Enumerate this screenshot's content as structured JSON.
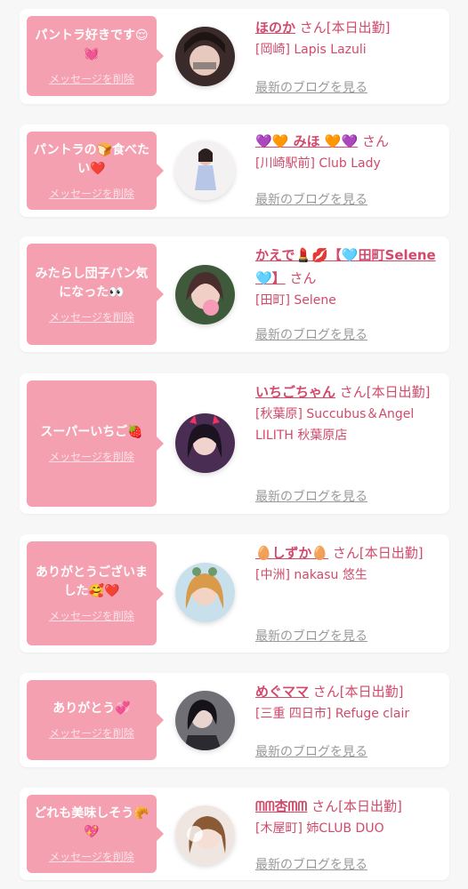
{
  "delete_label": "メッセージを削除",
  "colors": {
    "bubble": "#f4a0b1",
    "accent": "#d14a6b",
    "muted": "#999999"
  },
  "cards": [
    {
      "message": "パントラ好きです😌💓",
      "name": "ほのか",
      "suffix": "さん[本日出勤]",
      "shop": "[岡崎] Lapis Lazuli",
      "blog": "最新のブログを見る"
    },
    {
      "message": "パントラの🍞食べたい❤️",
      "name": "💜🧡 みほ 🧡💜",
      "suffix": "さん",
      "shop": "[川崎駅前] Club Lady",
      "blog": "最新のブログを見る"
    },
    {
      "message": "みたらし団子パン気になった👀",
      "name": "かえで💄💋【🩵田町Selene🩵】",
      "suffix": "さん",
      "shop": "[田町] Selene",
      "blog": "最新のブログを見る"
    },
    {
      "message": "スーパーいちご🍓",
      "name": "いちごちゃん",
      "suffix": "さん[本日出勤]",
      "shop": "[秋葉原] Succubus＆Angel LILITH 秋葉原店",
      "blog": "最新のブログを見る"
    },
    {
      "message": "ありがとうございました🥰❤️",
      "name": "🥚しずか🥚",
      "suffix": "さん[本日出勤]",
      "shop": "[中洲] nakasu 悠生",
      "blog": "最新のブログを見る"
    },
    {
      "message": "ありがとう💞",
      "name": "めぐママ",
      "suffix": "さん[本日出勤]",
      "shop": "[三重 四日市] Refuge clair",
      "blog": "最新のブログを見る"
    },
    {
      "message": "どれも美味しそう🥐💖",
      "name": "ᗰᗰ杏ᗰᗰ",
      "suffix": "さん[本日出勤]",
      "shop": "[木屋町] 姉CLUB DUO",
      "blog": "最新のブログを見る"
    }
  ]
}
